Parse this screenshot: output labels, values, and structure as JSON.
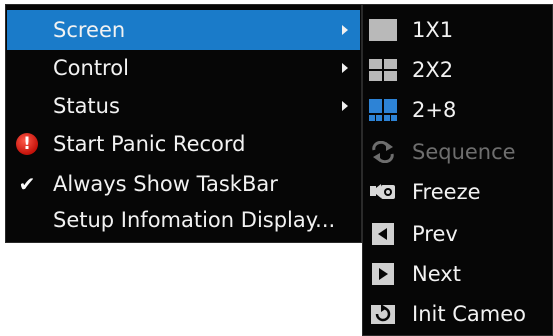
{
  "main_menu": {
    "items": [
      {
        "label": "Screen",
        "has_submenu": true,
        "selected": true
      },
      {
        "label": "Control",
        "has_submenu": true
      },
      {
        "label": "Status",
        "has_submenu": true
      },
      {
        "label": "Start Panic Record",
        "icon": "panic-alert-icon"
      },
      {
        "label": "Always Show TaskBar",
        "icon": "checkmark-icon",
        "checked": true
      },
      {
        "label": "Setup Infomation Display..."
      }
    ]
  },
  "screen_submenu": {
    "items": [
      {
        "label": "1X1",
        "icon": "single-view-icon"
      },
      {
        "label": "2X2",
        "icon": "quad-view-icon"
      },
      {
        "label": "2+8",
        "icon": "split-2plus8-view-icon"
      },
      {
        "label": "Sequence",
        "icon": "sequence-icon",
        "disabled": true
      },
      {
        "label": "Freeze",
        "icon": "freeze-camera-icon"
      },
      {
        "label": "Prev",
        "icon": "prev-icon"
      },
      {
        "label": "Next",
        "icon": "next-icon"
      },
      {
        "label": "Init Cameo",
        "icon": "init-cameo-icon"
      }
    ]
  },
  "colors": {
    "menu_bg": "#060606",
    "selected_bg": "#1a7bc9",
    "text": "#f2f2f2",
    "disabled_text": "#6e6e6e",
    "accent_blue": "#2d83d6"
  }
}
